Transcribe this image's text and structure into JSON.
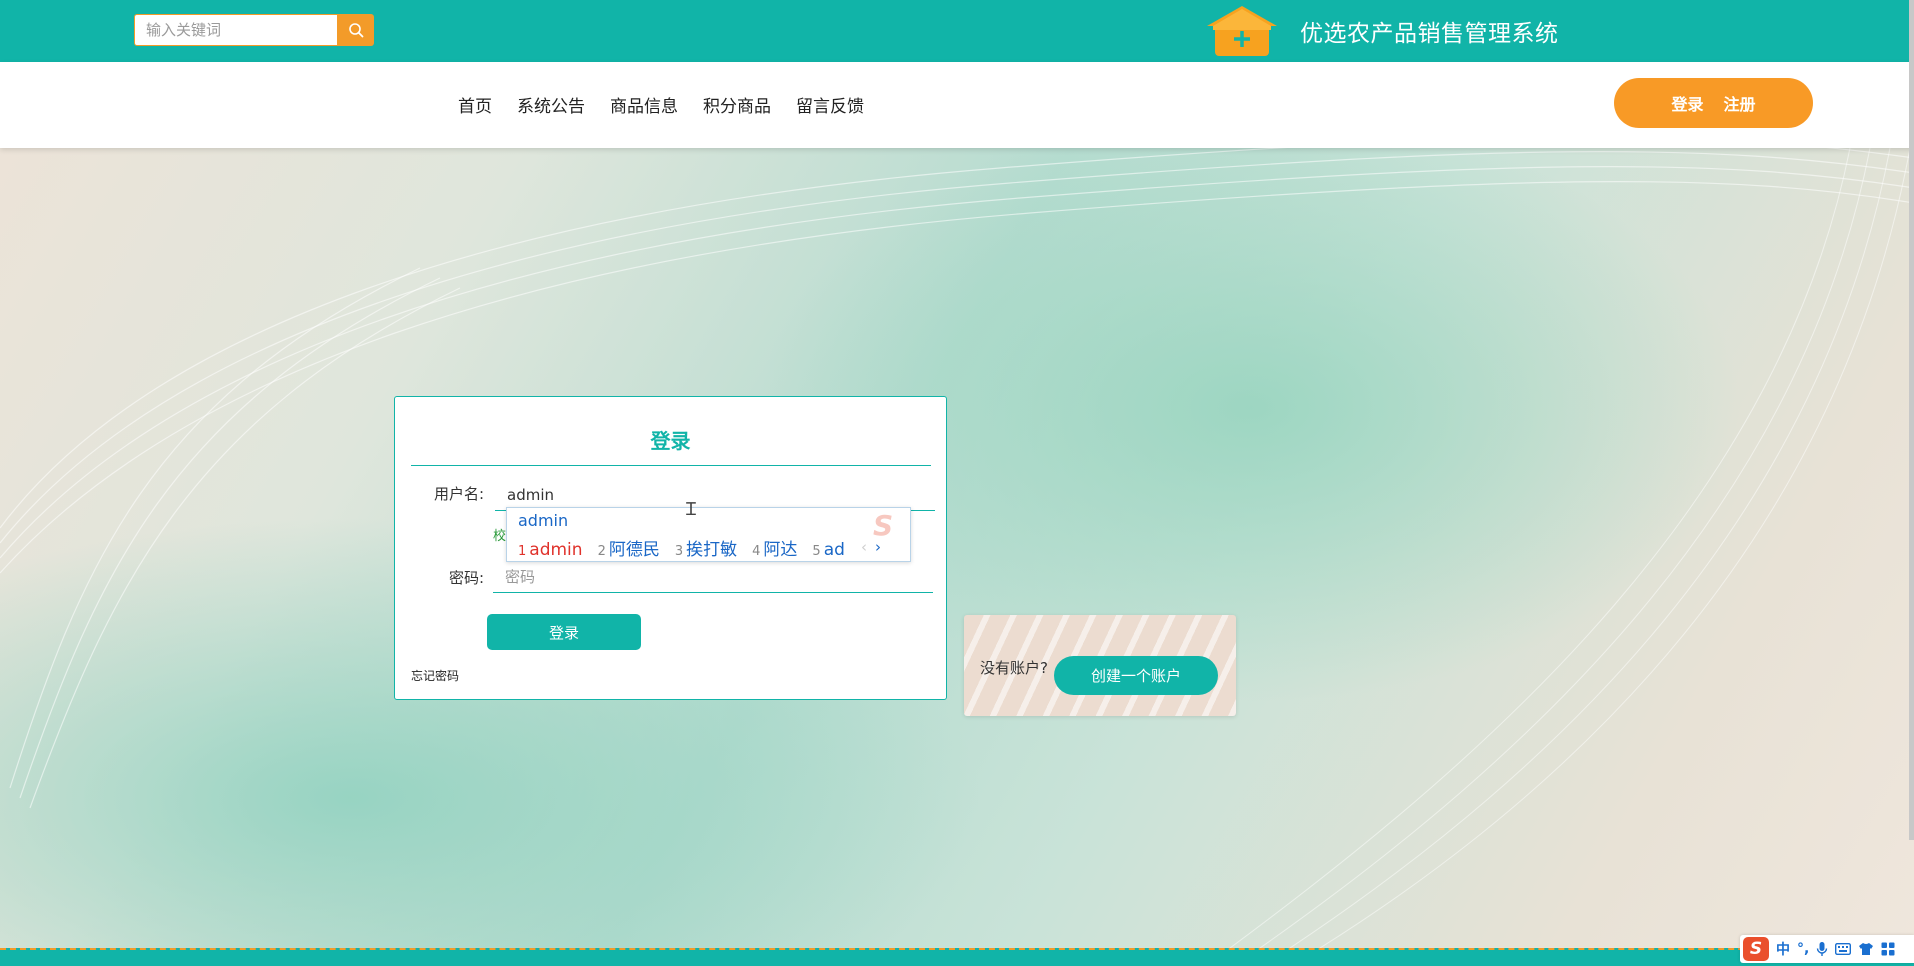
{
  "header": {
    "search_placeholder": "输入关键词",
    "site_title": "优选农产品销售管理系统"
  },
  "nav": {
    "items": [
      "首页",
      "系统公告",
      "商品信息",
      "积分商品",
      "留言反馈"
    ],
    "login_label": "登录",
    "register_label": "注册"
  },
  "login_form": {
    "title": "登录",
    "username_label": "用户名:",
    "username_value": "admin",
    "hint_partial": "校",
    "password_label": "密码:",
    "password_placeholder": "密码",
    "submit_label": "登录",
    "forgot_label": "忘记密码"
  },
  "ime_popup": {
    "composition": "admin",
    "candidates": [
      {
        "num": "1",
        "text": "admin"
      },
      {
        "num": "2",
        "text": "阿德民"
      },
      {
        "num": "3",
        "text": "挨打敏"
      },
      {
        "num": "4",
        "text": "阿达"
      },
      {
        "num": "5",
        "text": "ad"
      }
    ],
    "prev_glyph": "‹",
    "next_glyph": "›",
    "logo_glyph": "S"
  },
  "register_card": {
    "prompt": "没有账户?",
    "button_label": "创建一个账户"
  },
  "ime_toolbar": {
    "logo_glyph": "S",
    "mode_label": "中",
    "punct_label": "°,"
  },
  "colors": {
    "primary": "#11b4a8",
    "accent": "#f89a26"
  }
}
